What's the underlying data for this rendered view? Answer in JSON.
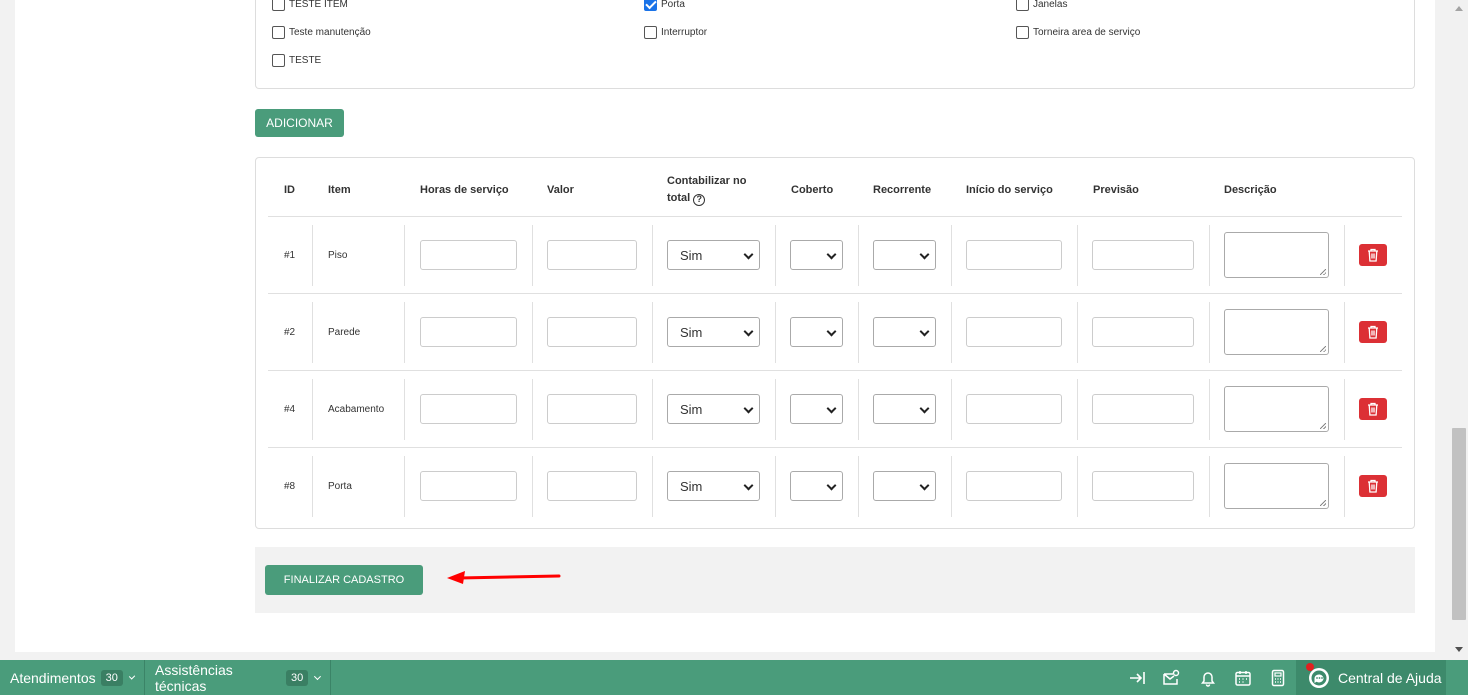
{
  "checkboxes": [
    {
      "label": "TESTE ITEM",
      "checked": false
    },
    {
      "label": "Porta",
      "checked": true
    },
    {
      "label": "Janelas",
      "checked": false
    },
    {
      "label": "Teste manutenção",
      "checked": false
    },
    {
      "label": "Interruptor",
      "checked": false
    },
    {
      "label": "Torneira area de serviço",
      "checked": false
    },
    {
      "label": "TESTE",
      "checked": false
    }
  ],
  "add_button": "ADICIONAR",
  "table": {
    "headers": {
      "id": "ID",
      "item": "Item",
      "horas": "Horas de serviço",
      "valor": "Valor",
      "contabilizar_1": "Contabilizar no",
      "contabilizar_2": "total",
      "coberto": "Coberto",
      "recorrente": "Recorrente",
      "inicio": "Início do serviço",
      "previsao": "Previsão",
      "descricao": "Descrição",
      "help_glyph": "?"
    },
    "rows": [
      {
        "id": "#1",
        "item": "Piso",
        "contabilizar": "Sim"
      },
      {
        "id": "#2",
        "item": "Parede",
        "contabilizar": "Sim"
      },
      {
        "id": "#4",
        "item": "Acabamento",
        "contabilizar": "Sim"
      },
      {
        "id": "#8",
        "item": "Porta",
        "contabilizar": "Sim"
      }
    ]
  },
  "finalize_button": "FINALIZAR CADASTRO",
  "annotation_arrow_color": "#ff0000",
  "colors": {
    "primary": "#4a9c7b",
    "danger": "#dc3035",
    "checked": "#1a73e8"
  },
  "bottom_bar": {
    "tabs": [
      {
        "label": "Atendimentos",
        "count": "30"
      },
      {
        "label": "Assistências técnicas",
        "count": "30"
      }
    ],
    "icons": [
      "arrow-right-bar-icon",
      "mail-settings-icon",
      "bell-icon",
      "calendar-icon",
      "calculator-icon"
    ],
    "help_label": "Central de Ajuda"
  }
}
